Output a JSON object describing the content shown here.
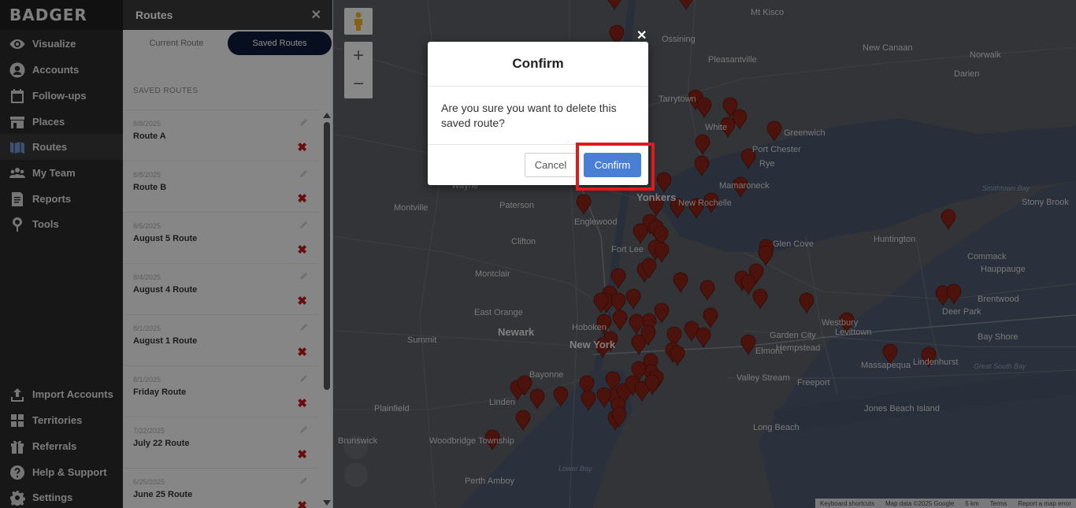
{
  "app": {
    "logo": "BADGER"
  },
  "nav": {
    "top": [
      {
        "label": "Visualize",
        "icon": "eye-icon"
      },
      {
        "label": "Accounts",
        "icon": "user-icon"
      },
      {
        "label": "Follow-ups",
        "icon": "calendar-icon"
      },
      {
        "label": "Places",
        "icon": "store-icon"
      },
      {
        "label": "Routes",
        "icon": "map-icon",
        "active": true
      },
      {
        "label": "My Team",
        "icon": "team-icon"
      },
      {
        "label": "Reports",
        "icon": "report-icon"
      },
      {
        "label": "Tools",
        "icon": "pin-icon"
      }
    ],
    "bottom": [
      {
        "label": "Import Accounts",
        "icon": "upload-icon"
      },
      {
        "label": "Territories",
        "icon": "grid-icon"
      },
      {
        "label": "Referrals",
        "icon": "gift-icon"
      },
      {
        "label": "Help & Support",
        "icon": "help-icon"
      },
      {
        "label": "Settings",
        "icon": "gear-icon"
      }
    ]
  },
  "panel": {
    "title": "Routes",
    "close": "✕",
    "tabs": {
      "current": "Current Route",
      "saved": "Saved Routes"
    },
    "saved_header": "SAVED ROUTES",
    "routes": [
      {
        "date": "8/8/2025",
        "name": "Route A"
      },
      {
        "date": "8/8/2025",
        "name": "Route B"
      },
      {
        "date": "8/5/2025",
        "name": "August 5 Route"
      },
      {
        "date": "8/4/2025",
        "name": "August 4 Route"
      },
      {
        "date": "8/1/2025",
        "name": "August 1 Route"
      },
      {
        "date": "8/1/2025",
        "name": "Friday Route"
      },
      {
        "date": "7/22/2025",
        "name": "July 22 Route"
      },
      {
        "date": "6/25/2025",
        "name": "June 25 Route"
      }
    ],
    "delete_glyph": "✖"
  },
  "map": {
    "labels": {
      "mt_kisco": "Mt Kisco",
      "ossining": "Ossining",
      "new_canaan": "New Canaan",
      "pleasantville": "Pleasantville",
      "darien": "Darien",
      "norwalk": "Norwalk",
      "tarrytown": "Tarrytown",
      "white_plains": "White",
      "greenwich": "Greenwich",
      "port_chester": "Port Chester",
      "rye": "Rye",
      "mamaroneck": "Mamaroneck",
      "wayne": "Wayne",
      "paterson": "Paterson",
      "yonkers": "Yonkers",
      "new_rochelle": "New Rochelle",
      "montville": "Montville",
      "englewood": "Englewood",
      "fort_lee": "Fort Lee",
      "clifton": "Clifton",
      "huntington": "Huntington",
      "commack": "Commack",
      "hauppauge": "Hauppauge",
      "stony_brook": "Stony Brook",
      "glen_cove": "Glen Cove",
      "montclair": "Montclair",
      "east_orange": "East Orange",
      "newark": "Newark",
      "new_york": "New York",
      "summit": "Summit",
      "hoboken": "Hoboken",
      "garden_city": "Garden City",
      "hempstead": "Hempstead",
      "levittown": "Levittown",
      "deer_park": "Deer Park",
      "brentwood": "Brentwood",
      "bay_shore": "Bay Shore",
      "massapequa": "Massapequa",
      "lindenhurst": "Lindenhurst",
      "valley_stream": "Valley Stream",
      "freeport": "Freeport",
      "elmont": "Elmont",
      "bayonne": "Bayonne",
      "linden": "Linden",
      "plainfield": "Plainfield",
      "woodbridge": "Woodbridge Township",
      "perth_amboy": "Perth Amboy",
      "long_beach": "Long Beach",
      "jones_beach": "Jones Beach Island",
      "westbury": "Westbury",
      "brunswick": "Brunswick",
      "smithtown_bay": "Smithtown Bay",
      "great_south_bay": "Great South Bay",
      "lower_bay": "Lower Bay"
    },
    "attribution": [
      "Keyboard shortcuts",
      "Map data ©2025 Google",
      "5 km",
      "Terms",
      "Report a map error"
    ]
  },
  "dialog": {
    "title": "Confirm",
    "message": "Are you sure you want to delete this saved route?",
    "cancel_label": "Cancel",
    "confirm_label": "Confirm",
    "close": "✕"
  }
}
